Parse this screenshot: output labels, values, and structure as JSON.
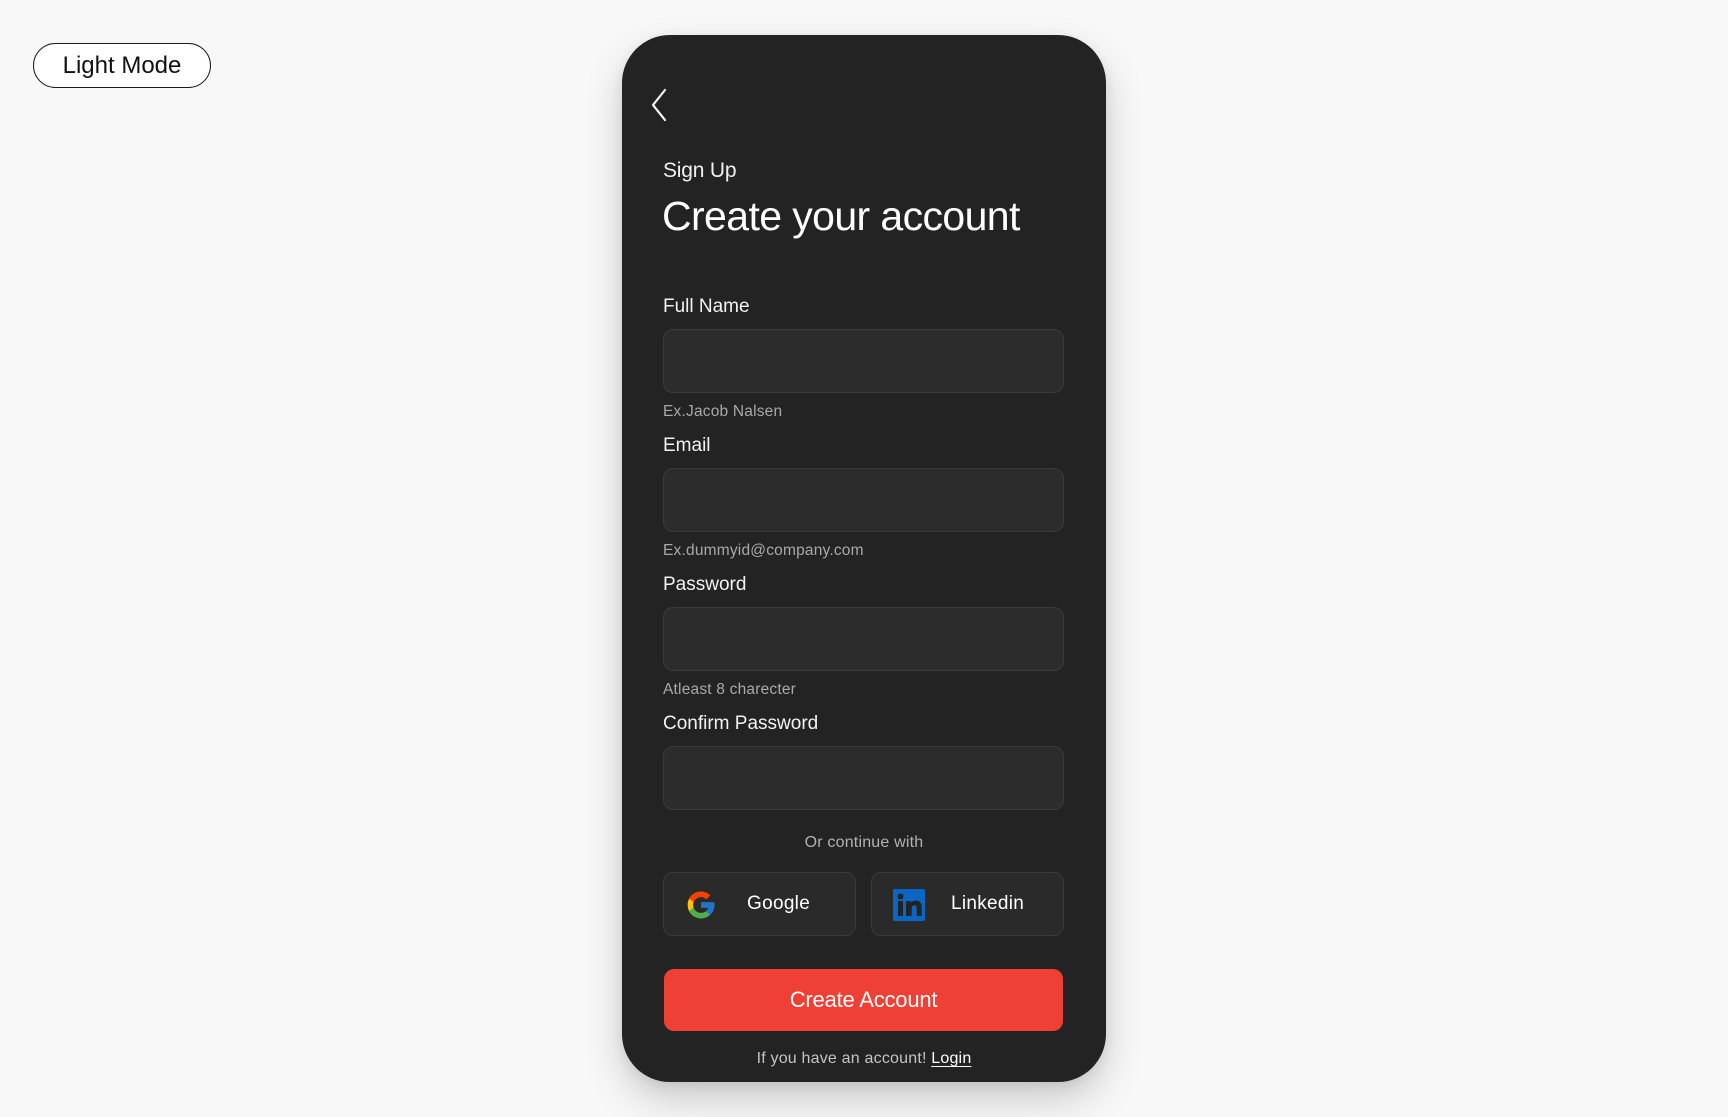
{
  "mode_toggle": {
    "label": "Light Mode"
  },
  "header": {
    "back_icon": "chevron-left-icon",
    "eyebrow": "Sign Up",
    "title": "Create your account"
  },
  "form": {
    "full_name": {
      "label": "Full Name",
      "value": "",
      "hint": "Ex.Jacob Nalsen"
    },
    "email": {
      "label": "Email",
      "value": "",
      "hint": "Ex.dummyid@company.com"
    },
    "password": {
      "label": "Password",
      "value": "",
      "hint": "Atleast 8 charecter"
    },
    "confirm_password": {
      "label": "Confirm Password",
      "value": ""
    }
  },
  "social": {
    "divider": "Or continue with",
    "google": {
      "label": "Google",
      "icon": "google-icon"
    },
    "linkedin": {
      "label": "Linkedin",
      "icon": "linkedin-icon"
    }
  },
  "primary_action": {
    "label": "Create Account"
  },
  "footer": {
    "prompt": "If you have an account!",
    "link": "Login"
  },
  "colors": {
    "background": "#f8f8f8",
    "panel": "#232323",
    "input": "#2c2c2c",
    "accent": "#ef4036",
    "linkedin": "#0a66c2"
  }
}
